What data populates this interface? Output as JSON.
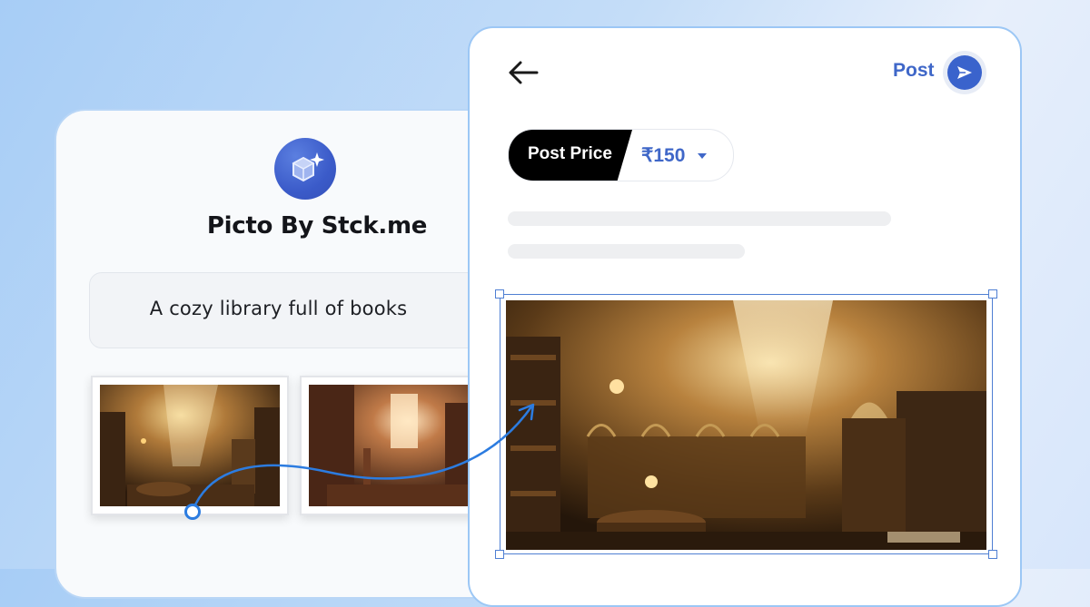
{
  "app": {
    "title": "Picto By Stck.me",
    "logo_icon": "sparkle-cube-icon"
  },
  "prompt": {
    "text": "A cozy library full of books"
  },
  "thumbnails": [
    {
      "description": "generated-image-1"
    },
    {
      "description": "generated-image-2"
    }
  ],
  "editor": {
    "back_icon": "arrow-left-icon",
    "post_label": "Post",
    "post_icon": "send-icon",
    "price_label": "Post Price",
    "price_value": "₹150",
    "price_dropdown_icon": "caret-down-icon"
  },
  "colors": {
    "accent_blue": "#3f67c8",
    "logo_blue": "#3b5bc9",
    "frame_blue": "#4f7fd3",
    "black": "#000000"
  }
}
